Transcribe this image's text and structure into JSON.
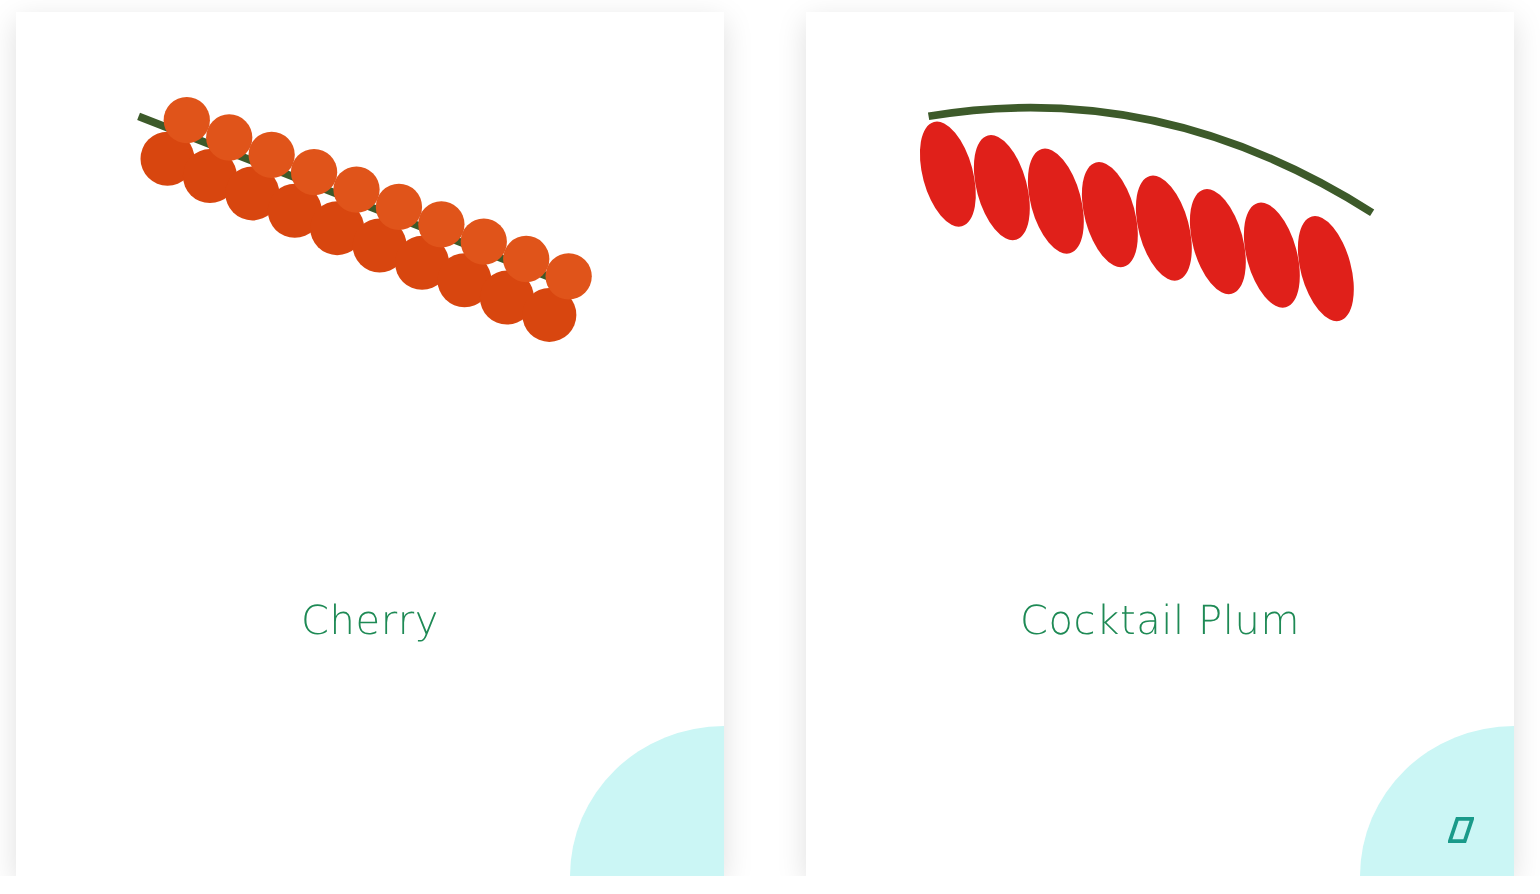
{
  "cards": [
    {
      "title": "Cherry",
      "kind": "round",
      "corner_icon": false
    },
    {
      "title": "Cocktail Plum",
      "kind": "plum",
      "corner_icon": true
    }
  ]
}
